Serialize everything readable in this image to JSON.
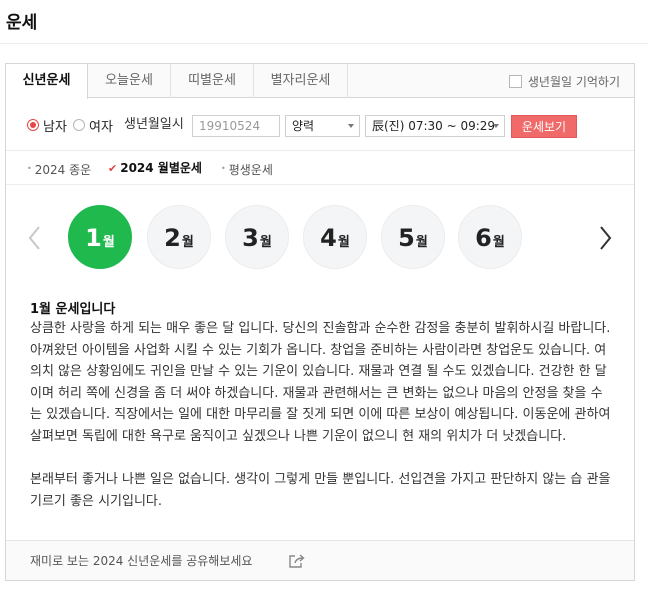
{
  "page": {
    "title": "운세"
  },
  "tabs": [
    {
      "label": "신년운세",
      "active": true
    },
    {
      "label": "오늘운세"
    },
    {
      "label": "띠별운세"
    },
    {
      "label": "별자리운세"
    }
  ],
  "remember_birth": {
    "label": "생년월일 기억하기",
    "checked": false
  },
  "form": {
    "gender_male": "남자",
    "gender_female": "여자",
    "birth_label": "생년월일시",
    "birth_placeholder": "19910524",
    "calendar_value": "양력",
    "time_value": "辰(진) 07:30 ~ 09:29",
    "submit_label": "운세보기"
  },
  "subtabs": [
    {
      "label": "2024 종운"
    },
    {
      "label": "2024 월별운세",
      "active": true
    },
    {
      "label": "평생운세"
    }
  ],
  "months": [
    {
      "num": "1",
      "unit": "월",
      "active": true
    },
    {
      "num": "2",
      "unit": "월"
    },
    {
      "num": "3",
      "unit": "월"
    },
    {
      "num": "4",
      "unit": "월"
    },
    {
      "num": "5",
      "unit": "월"
    },
    {
      "num": "6",
      "unit": "월"
    }
  ],
  "fortune": {
    "title": "1월 운세입니다",
    "paragraph1": "상큼한 사랑을 하게 되는 매우 좋은 달 입니다. 당신의 진솔함과 순수한 감정을 충분히 발휘하시길 바랍니다. 아껴왔던 아이템을 사업화 시킬 수 있는 기회가 옵니다. 창업을 준비하는 사람이라면 창업운도 있습니다. 여의치 않은 상황임에도 귀인을 만날 수 있는 기운이 있습니다. 재물과 연결 될 수도 있겠습니다. 건강한 한 달이며 허리 쪽에 신경을 좀 더 써야 하겠습니다. 재물과 관련해서는 큰 변화는 없으나 마음의 안정을 찾을 수는 있겠습니다. 직장에서는 일에 대한 마무리를 잘 짓게 되면 이에 따른 보상이 예상됩니다. 이동운에 관하여 살펴보면 독립에 대한 욕구로 움직이고 싶겠으나 나쁜 기운이 없으니 현 재의 위치가 더 낫겠습니다.",
    "paragraph2": "본래부터 좋거나 나쁜 일은 없습니다. 생각이 그렇게 만들 뿐입니다. 선입견을 가지고 판단하지 않는 습 관을 기르기 좋은 시기입니다."
  },
  "share": {
    "text": "재미로 보는 2024 신년운세를 공유해보세요"
  },
  "colors": {
    "accent_green": "#1fb94e",
    "accent_red": "#e64545",
    "button_red": "#f06a6a"
  }
}
